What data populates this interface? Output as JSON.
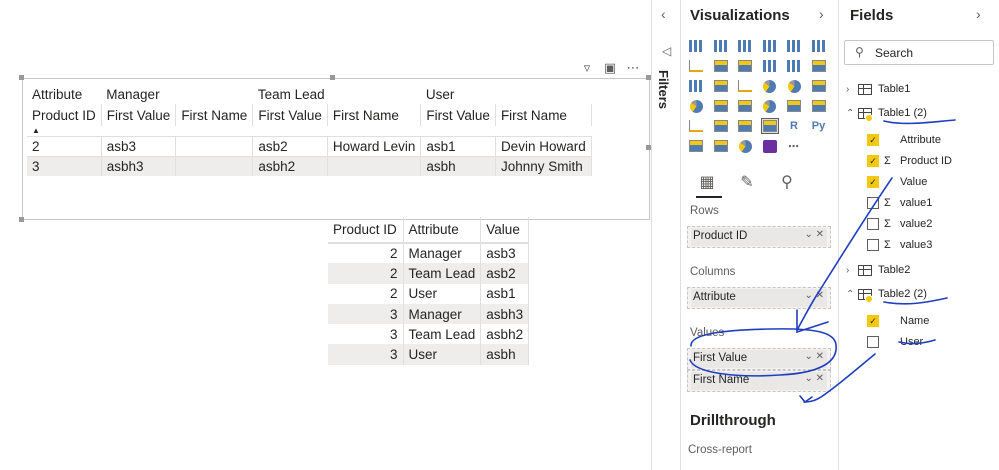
{
  "canvas": {
    "matrix": {
      "row_header_top": "Attribute",
      "row_header": "Product ID",
      "column_groups": [
        "Manager",
        "Team Lead",
        "User"
      ],
      "sub_headers": [
        "First Value",
        "First Name",
        "First Value",
        "First Name",
        "First Value",
        "First Name"
      ],
      "rows": [
        {
          "id": "2",
          "cells": [
            "asb3",
            "",
            "asb2",
            "Howard Levin",
            "asb1",
            "Devin Howard"
          ]
        },
        {
          "id": "3",
          "cells": [
            "asbh3",
            "",
            "asbh2",
            "",
            "asbh",
            "Johnny Smith"
          ]
        }
      ]
    },
    "table": {
      "headers": [
        "Product ID",
        "Attribute",
        "Value"
      ],
      "rows": [
        [
          "2",
          "Manager",
          "asb3"
        ],
        [
          "2",
          "Team Lead",
          "asb2"
        ],
        [
          "2",
          "User",
          "asb1"
        ],
        [
          "3",
          "Manager",
          "asbh3"
        ],
        [
          "3",
          "Team Lead",
          "asbh2"
        ],
        [
          "3",
          "User",
          "asbh"
        ]
      ]
    }
  },
  "filters": {
    "label": "Filters"
  },
  "visualizations": {
    "title": "Visualizations",
    "wells": {
      "rows_label": "Rows",
      "rows_field": "Product ID",
      "columns_label": "Columns",
      "columns_field": "Attribute",
      "values_label": "Values",
      "values_fields": [
        "First Value",
        "First Name"
      ]
    },
    "drillthrough": "Drillthrough",
    "cross_report": "Cross-report",
    "icons": [
      "stacked-bar-icon",
      "stacked-column-icon",
      "clustered-bar-icon",
      "clustered-column-icon",
      "100-bar-icon",
      "100-column-icon",
      "line-icon",
      "area-icon",
      "stacked-area-icon",
      "line-column-icon",
      "line-clustered-icon",
      "ribbon-icon",
      "waterfall-icon",
      "funnel-icon",
      "scatter-icon",
      "pie-icon",
      "donut-icon",
      "treemap-icon",
      "map-icon",
      "filled-map-icon",
      "shape-map-icon",
      "gauge-icon",
      "card-icon",
      "multirow-card-icon",
      "kpi-icon",
      "slicer-icon",
      "table-icon",
      "matrix-icon",
      "r-visual-icon",
      "python-visual-icon",
      "key-influencers-icon",
      "decomposition-tree-icon",
      "qna-icon",
      "power-apps-icon",
      "more-icon"
    ]
  },
  "fields": {
    "title": "Fields",
    "search_placeholder": "Search",
    "tree": {
      "table1": "Table1",
      "table1_2": "Table1 (2)",
      "table1_2_fields": [
        "Attribute",
        "Product ID",
        "Value",
        "value1",
        "value2",
        "value3"
      ],
      "table2": "Table2",
      "table2_2": "Table2 (2)",
      "table2_2_fields": [
        "Name",
        "User"
      ]
    }
  },
  "colors": {
    "accent": "#f2c811",
    "ink": "#1f3fbf",
    "selected_row": "#eeedec"
  }
}
